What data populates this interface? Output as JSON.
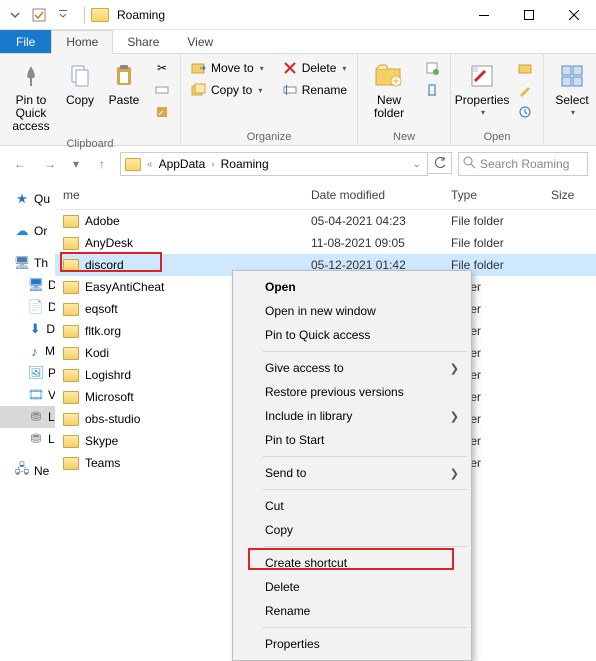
{
  "window": {
    "title": "Roaming",
    "search_placeholder": "Search Roaming"
  },
  "tabs": {
    "file": "File",
    "home": "Home",
    "share": "Share",
    "view": "View"
  },
  "ribbon": {
    "pin": "Pin to Quick access",
    "copy": "Copy",
    "paste": "Paste",
    "clipboard": "Clipboard",
    "moveto": "Move to",
    "copyto": "Copy to",
    "delete": "Delete",
    "rename": "Rename",
    "organize": "Organize",
    "newfolder": "New folder",
    "new": "New",
    "properties": "Properties",
    "open": "Open",
    "select": "Select"
  },
  "breadcrumbs": {
    "appdata": "AppData",
    "roaming": "Roaming"
  },
  "columns": {
    "name": "me",
    "date": "Date modified",
    "type": "Type",
    "size": "Size"
  },
  "nav": {
    "qu": "Qu",
    "or": "Or",
    "th": "Th",
    "d1": "D",
    "d2": "D",
    "d3": "D",
    "m": "M",
    "p": "P",
    "v": "V",
    "l1": "L",
    "l2": "L",
    "ne": "Ne"
  },
  "files": [
    {
      "name": "Adobe",
      "date": "05-04-2021 04:23",
      "type": "File folder"
    },
    {
      "name": "AnyDesk",
      "date": "11-08-2021 09:05",
      "type": "File folder"
    },
    {
      "name": "discord",
      "date": "05-12-2021 01:42",
      "type": "File folder",
      "selected": true
    },
    {
      "name": "EasyAntiCheat",
      "date": "",
      "type": "folder"
    },
    {
      "name": "eqsoft",
      "date": "",
      "type": "folder"
    },
    {
      "name": "fltk.org",
      "date": "",
      "type": "folder"
    },
    {
      "name": "Kodi",
      "date": "",
      "type": "folder"
    },
    {
      "name": "Logishrd",
      "date": "",
      "type": "folder"
    },
    {
      "name": "Microsoft",
      "date": "",
      "type": "folder"
    },
    {
      "name": "obs-studio",
      "date": "",
      "type": "folder"
    },
    {
      "name": "Skype",
      "date": "",
      "type": "folder"
    },
    {
      "name": "Teams",
      "date": "",
      "type": "folder"
    }
  ],
  "ctx": {
    "open": "Open",
    "open_new": "Open in new window",
    "pin_qa": "Pin to Quick access",
    "give_access": "Give access to",
    "restore": "Restore previous versions",
    "include": "Include in library",
    "pin_start": "Pin to Start",
    "send_to": "Send to",
    "cut": "Cut",
    "copy": "Copy",
    "shortcut": "Create shortcut",
    "delete": "Delete",
    "rename": "Rename",
    "properties": "Properties"
  }
}
